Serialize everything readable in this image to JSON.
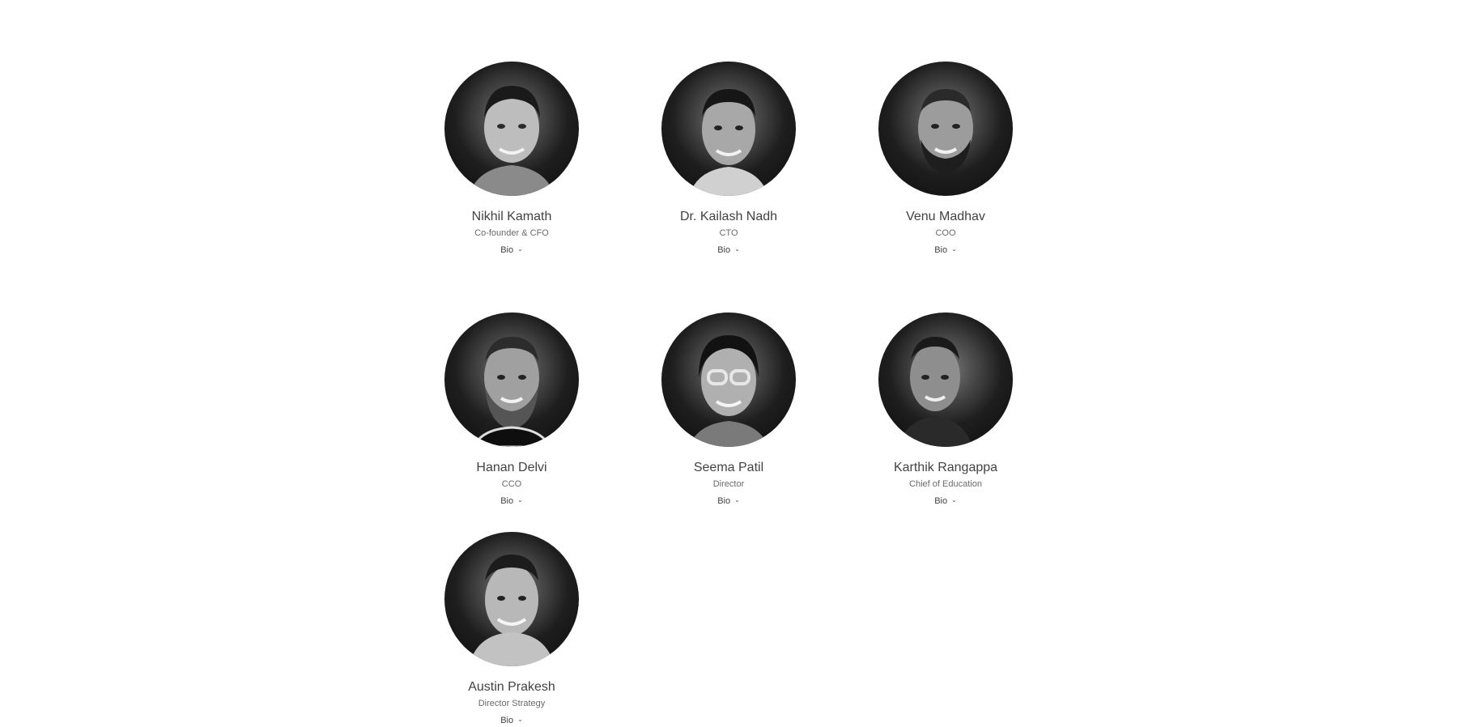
{
  "team": {
    "members": [
      {
        "name": "Nikhil Kamath",
        "role": "Co-founder & CFO",
        "bio_label": "Bio",
        "bio_icon": "chevron-down-icon"
      },
      {
        "name": "Dr. Kailash Nadh",
        "role": "CTO",
        "bio_label": "Bio",
        "bio_icon": "chevron-down-icon"
      },
      {
        "name": "Venu Madhav",
        "role": "COO",
        "bio_label": "Bio",
        "bio_icon": "chevron-down-icon"
      },
      {
        "name": "Hanan Delvi",
        "role": "CCO",
        "bio_label": "Bio",
        "bio_icon": "chevron-down-icon"
      },
      {
        "name": "Seema Patil",
        "role": "Director",
        "bio_label": "Bio",
        "bio_icon": "chevron-down-icon"
      },
      {
        "name": "Karthik Rangappa",
        "role": "Chief of Education",
        "bio_label": "Bio",
        "bio_icon": "chevron-down-icon"
      },
      {
        "name": "Austin Prakesh",
        "role": "Director Strategy",
        "bio_label": "Bio",
        "bio_icon": "chevron-down-icon"
      }
    ]
  },
  "colors": {
    "background": "#ffffff",
    "text": "#424242",
    "muted_text": "#6a6a6a",
    "photo_dark": "#0c0c0c"
  }
}
